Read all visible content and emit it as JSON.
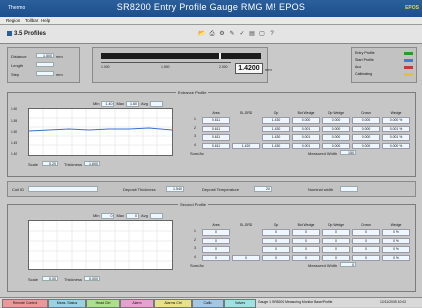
{
  "window": {
    "brand_left": "Thermo",
    "title": "SR8200 Entry Profile Gauge RMG M! EPOS",
    "brand_right": "EPOS"
  },
  "menu": [
    "Region",
    "Tollbar",
    "Help"
  ],
  "toolbar": {
    "tab_label": "3.5 Profiles",
    "icons": [
      "open-icon",
      "print-icon",
      "settings-icon",
      "tools-icon",
      "check-icon",
      "chart-icon",
      "window-icon",
      "help-icon"
    ]
  },
  "top": {
    "fields": [
      {
        "label": "Distance",
        "value": "1.500",
        "unit": "mm"
      },
      {
        "label": "Length",
        "value": "",
        "unit": ""
      },
      {
        "label": "Step",
        "value": "",
        "unit": "mm"
      }
    ],
    "ruler": {
      "ticks": [
        "1.000",
        "1.500",
        "2.000"
      ]
    },
    "big_value": "1.4200",
    "big_unit": "mm",
    "legend": [
      {
        "label": "Entry Profile",
        "color": "#2a9a2a"
      },
      {
        "label": "Start Profile",
        "color": "#3a7fd6"
      },
      {
        "label": "Aux",
        "color": "#c23a3a"
      },
      {
        "label": "Calibrating",
        "color": "#d8c53a"
      }
    ]
  },
  "entry_profile": {
    "title": "Entrance Profile",
    "range_fields": [
      "Min",
      "1.40",
      "Max",
      "1.60",
      "Avg"
    ],
    "scale_label": "Scale",
    "scale_value": "0.20",
    "thickness_label": "Thickness",
    "thickness_value": "1.600",
    "y_ticks": [
      "1.60",
      "1.55",
      "1.50",
      "1.45",
      "1.40"
    ],
    "table_headers": [
      "Area",
      "SL-SRD",
      "Op",
      "Bot Wedge",
      "Op Wedge",
      "Crown",
      "Wedge"
    ],
    "rows": [
      {
        "label": "1",
        "cells": [
          "0.611",
          "",
          "1.430",
          "0.000",
          "0.000",
          "0.000",
          "0.000 %"
        ]
      },
      {
        "label": "2",
        "cells": [
          "0.611",
          "",
          "1.430",
          "0.001",
          "0.000",
          "0.000",
          "0.001 %"
        ]
      },
      {
        "label": "3",
        "cells": [
          "0.611",
          "",
          "1.430",
          "0.001",
          "0.000",
          "0.000",
          "0.001 %"
        ]
      },
      {
        "label": "4",
        "cells": [
          "0.611",
          "1.420",
          "1.430",
          "0.001",
          "0.000",
          "0.000",
          "0.000 %"
        ]
      }
    ],
    "footer_left_label": "Sum/Av",
    "footer_right_label": "Measured Width",
    "footer_right_value": "150"
  },
  "middle": {
    "coil_label": "Coil ID",
    "deposit_thickness_label": "Deposit Thickness",
    "deposit_thickness_value": "1.540",
    "deposit_temp_label": "Deposit Temperature",
    "deposit_temp_value": "20",
    "nominal_width_label": "Nominal width",
    "nominal_width_value": ""
  },
  "second_profile": {
    "title": "Second Profile",
    "range_fields": [
      "Min",
      "0",
      "Max",
      "0",
      "Avg"
    ],
    "scale_label": "Scale",
    "scale_value": "0.00",
    "thickness_label": "Thickness",
    "thickness_value": "0.000",
    "table_headers": [
      "Area",
      "SL-SRD",
      "Op",
      "Bot Wedge",
      "Op Wedge",
      "Crown",
      "Wedge"
    ],
    "rows": [
      {
        "label": "1",
        "cells": [
          "0",
          "",
          "0",
          "0",
          "0",
          "0",
          "0 %"
        ]
      },
      {
        "label": "2",
        "cells": [
          "0",
          "",
          "0",
          "0",
          "0",
          "0",
          "0 %"
        ]
      },
      {
        "label": "3",
        "cells": [
          "0",
          "",
          "0",
          "0",
          "0",
          "0",
          "0 %"
        ]
      },
      {
        "label": "4",
        "cells": [
          "0",
          "0",
          "0",
          "0",
          "0",
          "0",
          "0 %"
        ]
      }
    ],
    "footer_left_label": "Sum/Av",
    "footer_right_label": "Measured Width",
    "footer_right_value": "0"
  },
  "statusbar": {
    "left_text": "Remote Control",
    "buttons": [
      {
        "label": "Remote Control",
        "color": "#e89a9a"
      },
      {
        "label": "Meas. Status",
        "color": "#9ad0e8"
      },
      {
        "label": "Head Ctrl",
        "color": "#a8e08c"
      },
      {
        "label": "Alarm",
        "color": "#e8a0d0"
      },
      {
        "label": "Alarms Ctrl",
        "color": "#e8e08c"
      },
      {
        "label": "Calib.",
        "color": "#a0c8e8"
      },
      {
        "label": "Valves",
        "color": "#a0e0e0"
      }
    ],
    "info_text": "Gauge 1 SR8200 Measuring Monitor   Base/Profile",
    "date": "12/11/2005 10:02"
  }
}
